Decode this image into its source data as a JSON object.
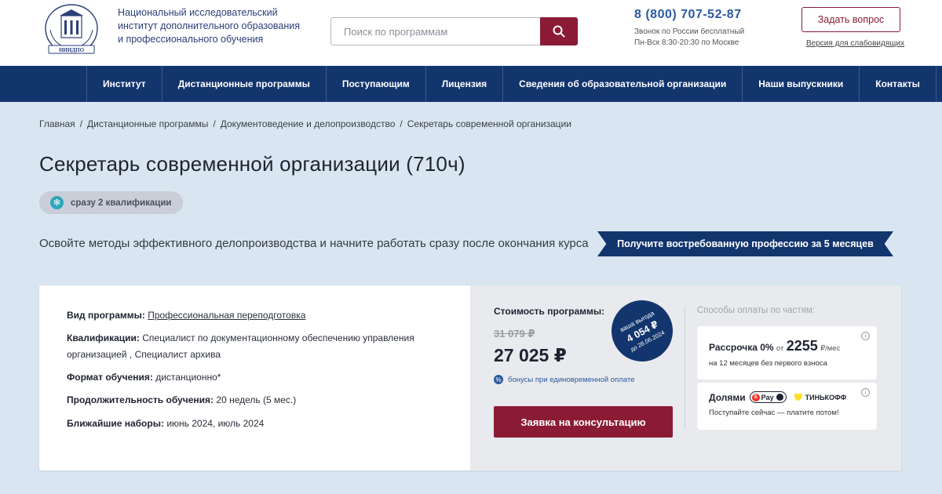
{
  "header": {
    "org_name": "Национальный исследовательский институт дополнительного образования и профессионального обучения",
    "logo_text": "НИИДПО",
    "search_placeholder": "Поиск по программам",
    "phone": "8 (800) 707-52-87",
    "phone_note_1": "Звонок по России бесплатный",
    "phone_note_2": "Пн-Вск 8:30-20:30 по Москве",
    "ask_button": "Задать вопрос",
    "access_link": "Версия для слабовидящих"
  },
  "nav": {
    "items": [
      "Институт",
      "Дистанционные программы",
      "Поступающим",
      "Лицензия",
      "Сведения об образовательной организации",
      "Наши выпускники",
      "Контакты"
    ]
  },
  "breadcrumb": [
    "Главная",
    "Дистанционные программы",
    "Документоведение и делопроизводство",
    "Секретарь современной организации"
  ],
  "page": {
    "title": "Секретарь современной организации (710ч)",
    "badge": "сразу 2 квалификации",
    "subtitle": "Освойте методы эффективного делопроизводства и начните работать сразу после окончания курса",
    "ribbon": "Получите востребованную профессию за 5 месяцев"
  },
  "program": {
    "type_label": "Вид программы:",
    "type_value": "Профессиональная переподготовка",
    "qual_label": "Квалификации:",
    "qual_value": "Специалист по документационному обеспечению управления организацией , Специалист архива",
    "format_label": "Формат обучения:",
    "format_value": "дистанционно*",
    "duration_label": "Продолжительность обучения:",
    "duration_value": "20 недель (5 мес.)",
    "intake_label": "Ближайшие наборы:",
    "intake_value": "июнь 2024, июль 2024"
  },
  "pricing": {
    "cost_label": "Стоимость программы:",
    "old_price": "31 079 ₽",
    "new_price": "27 025 ₽",
    "bonus_text": "бонусы при единовременной оплате",
    "benefit_line1": "ваша выгода",
    "benefit_amount": "4 054 ₽",
    "benefit_date": "до 28.06.2024",
    "consult_button": "Заявка на консультацию"
  },
  "payment": {
    "title": "Способы оплаты по частям:",
    "installment_label": "Рассрочка 0%",
    "installment_from": "от",
    "installment_amount": "2255",
    "installment_unit": "₽/мес",
    "installment_note": "на 12 месяцев без первого взноса",
    "dolyami_label": "Долями",
    "spay_text": "Pay",
    "tinkoff_text": "ТИНЬКОФФ",
    "dolyami_note": "Поступайте сейчас — платите потом!"
  },
  "colors": {
    "brand_navy": "#13356e",
    "brand_maroon": "#8b1b35",
    "page_bg": "#d9e6f1",
    "link_blue": "#2b5aa0"
  }
}
